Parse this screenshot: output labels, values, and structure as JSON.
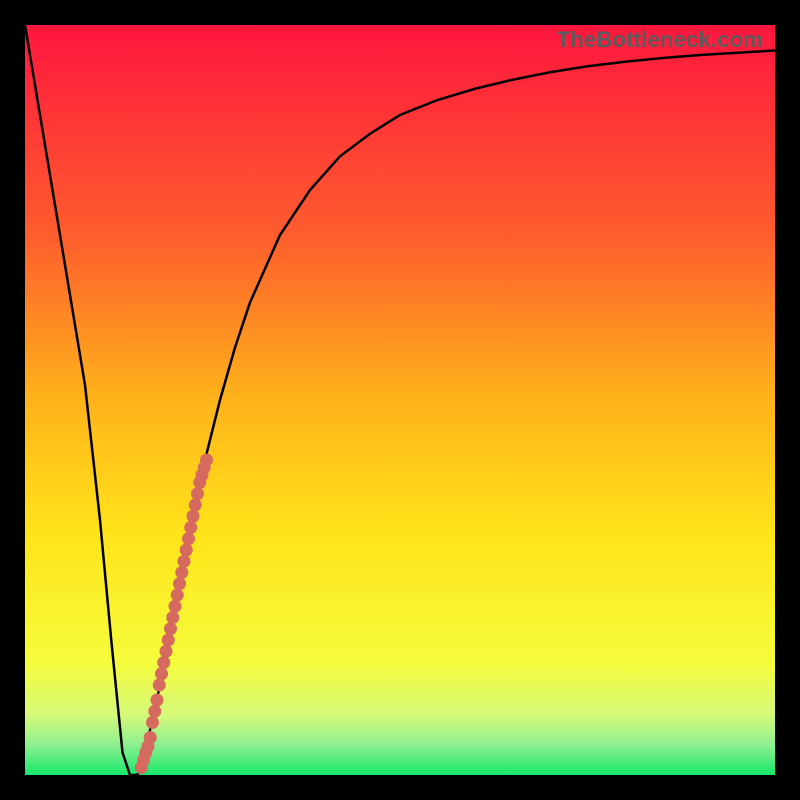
{
  "watermark": "TheBottleneck.com",
  "colors": {
    "frame": "#000000",
    "curve": "#000000",
    "dots": "#d66a5e",
    "gradient_top": "#ff163e",
    "gradient_mid_upper": "#ff8f2a",
    "gradient_mid": "#ffe41a",
    "gradient_mid_lower": "#eef760",
    "gradient_bottom": "#17e86b"
  },
  "chart_data": {
    "type": "line",
    "title": "",
    "xlabel": "",
    "ylabel": "",
    "xlim": [
      0,
      100
    ],
    "ylim": [
      0,
      100
    ],
    "series": [
      {
        "name": "bottleneck-curve",
        "x": [
          0,
          2,
          4,
          6,
          8,
          10,
          11.5,
          13,
          14,
          15,
          16,
          18,
          20,
          22,
          24,
          26,
          28,
          30,
          34,
          38,
          42,
          46,
          50,
          55,
          60,
          65,
          70,
          75,
          80,
          85,
          90,
          95,
          100
        ],
        "y": [
          100,
          88,
          76,
          64,
          52,
          34,
          18,
          3,
          0,
          0,
          3,
          12,
          22,
          32,
          42,
          50,
          57,
          63,
          72,
          78,
          82.5,
          85.5,
          88,
          90,
          91.5,
          92.7,
          93.7,
          94.5,
          95.1,
          95.6,
          96,
          96.3,
          96.6
        ]
      }
    ],
    "scatter": {
      "name": "marked-points",
      "x": [
        15.5,
        15.8,
        16.1,
        16.4,
        16.7,
        17.0,
        17.3,
        17.6,
        17.9,
        18.2,
        18.5,
        18.8,
        19.1,
        19.4,
        19.7,
        20.0,
        20.3,
        20.6,
        20.9,
        21.2,
        21.5,
        21.8,
        22.1,
        22.4,
        22.7,
        23.0,
        23.3,
        23.6,
        23.9,
        24.2
      ],
      "y": [
        1.0,
        2.0,
        3.0,
        3.8,
        5.0,
        7.0,
        8.5,
        10.0,
        12.0,
        13.5,
        15.0,
        16.5,
        18.0,
        19.5,
        21.0,
        22.5,
        24.0,
        25.5,
        27.0,
        28.5,
        30.0,
        31.5,
        33.0,
        34.5,
        36.0,
        37.5,
        39.0,
        40.0,
        41.0,
        42.0
      ]
    },
    "gradient_stops": [
      {
        "offset": 0,
        "color": "#ff163e"
      },
      {
        "offset": 28,
        "color": "#ff5d2d"
      },
      {
        "offset": 50,
        "color": "#ffb31a"
      },
      {
        "offset": 68,
        "color": "#ffe41a"
      },
      {
        "offset": 85,
        "color": "#f5fc3b"
      },
      {
        "offset": 92,
        "color": "#d6f97a"
      },
      {
        "offset": 96,
        "color": "#8df08f"
      },
      {
        "offset": 100,
        "color": "#17e86b"
      }
    ]
  }
}
